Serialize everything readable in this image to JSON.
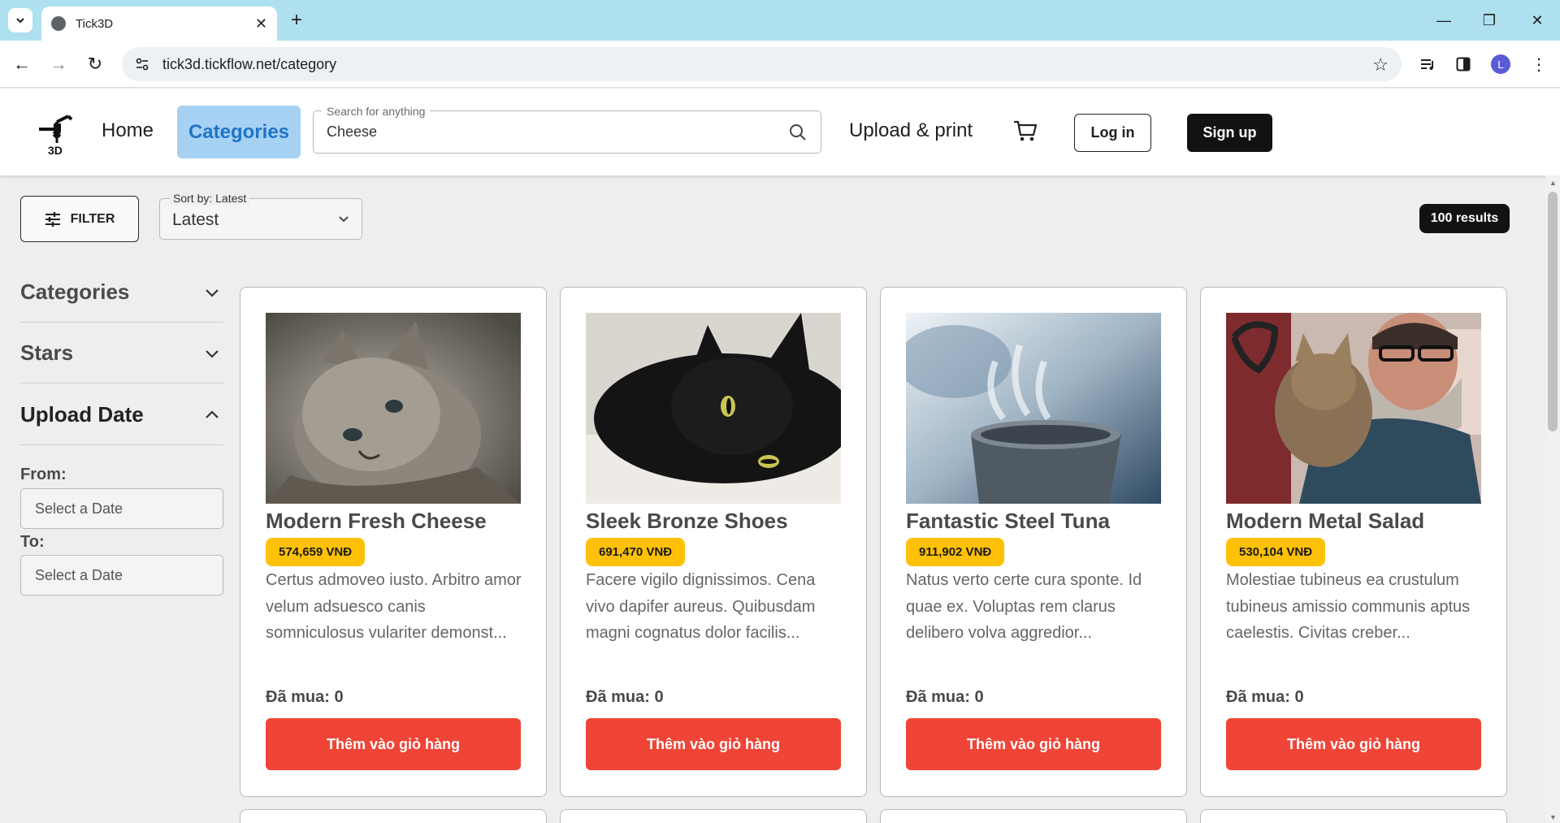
{
  "browser": {
    "tab_title": "Tick3D",
    "url": "tick3d.tickflow.net/category",
    "profile_initial": "L"
  },
  "header": {
    "home_label": "Home",
    "categories_label": "Categories",
    "search_label": "Search for anything",
    "search_value": "Cheese",
    "upload_label": "Upload & print",
    "login_label": "Log in",
    "signup_label": "Sign up",
    "logo_text": "3D"
  },
  "controls": {
    "filter_label": "FILTER",
    "sort_label": "Sort by: Latest",
    "sort_value": "Latest",
    "results": "100 results"
  },
  "sidebar": {
    "sections": [
      {
        "label": "Categories",
        "expanded": false
      },
      {
        "label": "Stars",
        "expanded": false
      },
      {
        "label": "Upload Date",
        "expanded": true
      }
    ],
    "from_label": "From:",
    "from_placeholder": "Select a Date",
    "to_label": "To:",
    "to_placeholder": "Select a Date"
  },
  "products": [
    {
      "name": "Modern Fresh Cheese",
      "price": "574,659 VNĐ",
      "description": "Certus admoveo iusto. Arbitro amor velum adsuesco canis somniculosus vulariter demonst...",
      "bought": "Đã mua: 0",
      "button": "Thêm vào giỏ hàng",
      "image": "gray-tabby-kitten"
    },
    {
      "name": "Sleek Bronze Shoes",
      "price": "691,470 VNĐ",
      "description": "Facere vigilo dignissimos. Cena vivo dapifer aureus. Quibusdam magni cognatus dolor facilis...",
      "bought": "Đã mua: 0",
      "button": "Thêm vào giỏ hàng",
      "image": "black-cat"
    },
    {
      "name": "Fantastic Steel Tuna",
      "price": "911,902 VNĐ",
      "description": "Natus verto certe cura sponte. Id quae ex. Voluptas rem clarus delibero volva aggredior...",
      "bought": "Đã mua: 0",
      "button": "Thêm vào giỏ hàng",
      "image": "steaming-cup"
    },
    {
      "name": "Modern Metal Salad",
      "price": "530,104 VNĐ",
      "description": "Molestiae tubineus ea crustulum tubineus amissio communis aptus caelestis. Civitas creber...",
      "bought": "Đã mua: 0",
      "button": "Thêm vào giỏ hàng",
      "image": "man-with-kitten"
    }
  ],
  "colors": {
    "tabbar": "#aee0ef",
    "accent_blue": "#1e74c9",
    "price_badge": "#ffc107",
    "cart_button": "#f04436"
  }
}
